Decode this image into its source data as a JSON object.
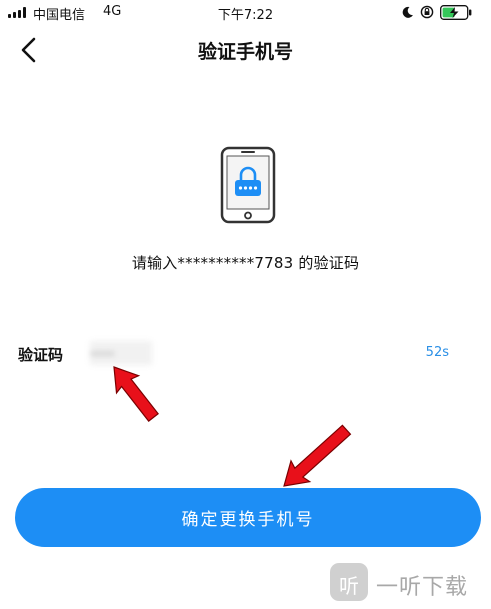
{
  "status_bar": {
    "carrier": "中国电信",
    "network": "4G",
    "time": "下午7:22"
  },
  "header": {
    "title": "验证手机号"
  },
  "main": {
    "prompt": "请输入**********7783 的验证码",
    "code_label": "验证码",
    "code_value": "•••••",
    "countdown": "52s"
  },
  "footer": {
    "confirm_label": "确定更换手机号"
  },
  "colors": {
    "accent": "#1d8ef5",
    "countdown": "#2a8fe6",
    "annotation_arrow": "#e8101a"
  },
  "icons": {
    "back": "chevron-left-icon",
    "illustration": "phone-lock-icon",
    "moon": "moon-icon",
    "rotation_lock": "rotation-lock-icon",
    "battery": "battery-charging-icon"
  },
  "watermark": {
    "logo_glyph": "听",
    "text": "一听下载"
  }
}
